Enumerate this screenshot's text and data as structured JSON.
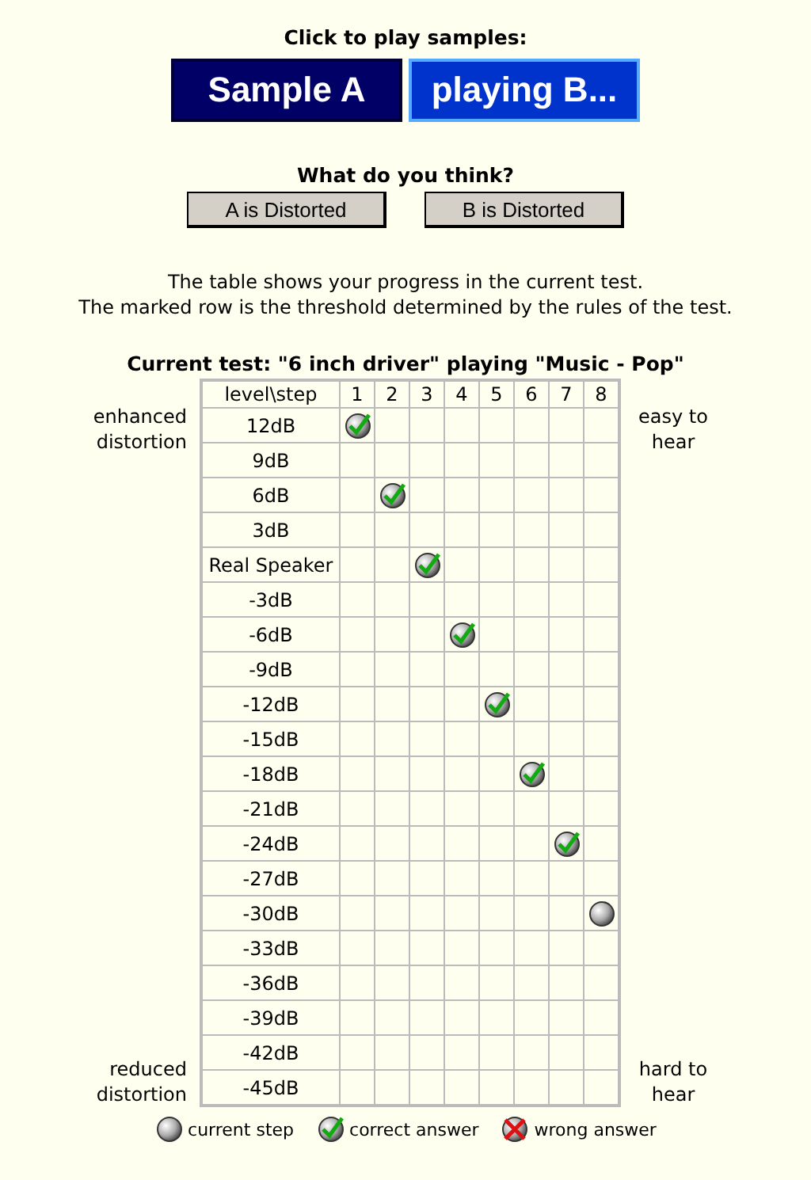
{
  "samples": {
    "heading": "Click to play samples:",
    "buttons": [
      {
        "label": "Sample A",
        "playing": false
      },
      {
        "label": "playing B...",
        "playing": true
      }
    ]
  },
  "vote": {
    "heading": "What do you think?",
    "buttons": [
      "A is Distorted",
      "B is Distorted"
    ]
  },
  "intro": [
    "The table shows your progress in the current test.",
    "The marked row is the threshold determined by the rules of the test."
  ],
  "test_title": "Current test: \"6 inch driver\" playing \"Music - Pop\"",
  "side_labels": {
    "top_left": "enhanced distortion",
    "top_right": "easy to hear",
    "bottom_left": "reduced distortion",
    "bottom_right": "hard to hear"
  },
  "table": {
    "corner": "level\\step",
    "steps": [
      "1",
      "2",
      "3",
      "4",
      "5",
      "6",
      "7",
      "8"
    ],
    "rows": [
      {
        "level": "12dB",
        "cells": [
          {
            "kind": "correct"
          },
          {
            "kind": "empty"
          },
          {
            "kind": "empty"
          },
          {
            "kind": "empty"
          },
          {
            "kind": "empty"
          },
          {
            "kind": "empty"
          },
          {
            "kind": "empty"
          },
          {
            "kind": "empty"
          }
        ]
      },
      {
        "level": "9dB",
        "cells": [
          {
            "kind": "empty"
          },
          {
            "kind": "empty"
          },
          {
            "kind": "empty"
          },
          {
            "kind": "empty"
          },
          {
            "kind": "empty"
          },
          {
            "kind": "empty"
          },
          {
            "kind": "empty"
          },
          {
            "kind": "empty"
          }
        ]
      },
      {
        "level": "6dB",
        "cells": [
          {
            "kind": "empty"
          },
          {
            "kind": "correct"
          },
          {
            "kind": "empty"
          },
          {
            "kind": "empty"
          },
          {
            "kind": "empty"
          },
          {
            "kind": "empty"
          },
          {
            "kind": "empty"
          },
          {
            "kind": "empty"
          }
        ]
      },
      {
        "level": "3dB",
        "cells": [
          {
            "kind": "empty"
          },
          {
            "kind": "empty"
          },
          {
            "kind": "empty"
          },
          {
            "kind": "empty"
          },
          {
            "kind": "empty"
          },
          {
            "kind": "empty"
          },
          {
            "kind": "empty"
          },
          {
            "kind": "empty"
          }
        ]
      },
      {
        "level": "Real Speaker",
        "cells": [
          {
            "kind": "empty"
          },
          {
            "kind": "empty"
          },
          {
            "kind": "correct"
          },
          {
            "kind": "empty"
          },
          {
            "kind": "empty"
          },
          {
            "kind": "empty"
          },
          {
            "kind": "empty"
          },
          {
            "kind": "empty"
          }
        ]
      },
      {
        "level": "-3dB",
        "cells": [
          {
            "kind": "empty"
          },
          {
            "kind": "empty"
          },
          {
            "kind": "empty"
          },
          {
            "kind": "empty"
          },
          {
            "kind": "empty"
          },
          {
            "kind": "empty"
          },
          {
            "kind": "empty"
          },
          {
            "kind": "empty"
          }
        ]
      },
      {
        "level": "-6dB",
        "cells": [
          {
            "kind": "empty"
          },
          {
            "kind": "empty"
          },
          {
            "kind": "empty"
          },
          {
            "kind": "correct"
          },
          {
            "kind": "empty"
          },
          {
            "kind": "empty"
          },
          {
            "kind": "empty"
          },
          {
            "kind": "empty"
          }
        ]
      },
      {
        "level": "-9dB",
        "cells": [
          {
            "kind": "empty"
          },
          {
            "kind": "empty"
          },
          {
            "kind": "empty"
          },
          {
            "kind": "empty"
          },
          {
            "kind": "empty"
          },
          {
            "kind": "empty"
          },
          {
            "kind": "empty"
          },
          {
            "kind": "empty"
          }
        ]
      },
      {
        "level": "-12dB",
        "cells": [
          {
            "kind": "empty"
          },
          {
            "kind": "empty"
          },
          {
            "kind": "empty"
          },
          {
            "kind": "empty"
          },
          {
            "kind": "correct"
          },
          {
            "kind": "empty"
          },
          {
            "kind": "empty"
          },
          {
            "kind": "empty"
          }
        ]
      },
      {
        "level": "-15dB",
        "cells": [
          {
            "kind": "empty"
          },
          {
            "kind": "empty"
          },
          {
            "kind": "empty"
          },
          {
            "kind": "empty"
          },
          {
            "kind": "empty"
          },
          {
            "kind": "empty"
          },
          {
            "kind": "empty"
          },
          {
            "kind": "empty"
          }
        ]
      },
      {
        "level": "-18dB",
        "cells": [
          {
            "kind": "empty"
          },
          {
            "kind": "empty"
          },
          {
            "kind": "empty"
          },
          {
            "kind": "empty"
          },
          {
            "kind": "empty"
          },
          {
            "kind": "correct"
          },
          {
            "kind": "empty"
          },
          {
            "kind": "empty"
          }
        ]
      },
      {
        "level": "-21dB",
        "cells": [
          {
            "kind": "empty"
          },
          {
            "kind": "empty"
          },
          {
            "kind": "empty"
          },
          {
            "kind": "empty"
          },
          {
            "kind": "empty"
          },
          {
            "kind": "empty"
          },
          {
            "kind": "empty"
          },
          {
            "kind": "empty"
          }
        ]
      },
      {
        "level": "-24dB",
        "cells": [
          {
            "kind": "empty"
          },
          {
            "kind": "empty"
          },
          {
            "kind": "empty"
          },
          {
            "kind": "empty"
          },
          {
            "kind": "empty"
          },
          {
            "kind": "empty"
          },
          {
            "kind": "correct"
          },
          {
            "kind": "empty"
          }
        ]
      },
      {
        "level": "-27dB",
        "cells": [
          {
            "kind": "empty"
          },
          {
            "kind": "empty"
          },
          {
            "kind": "empty"
          },
          {
            "kind": "empty"
          },
          {
            "kind": "empty"
          },
          {
            "kind": "empty"
          },
          {
            "kind": "empty"
          },
          {
            "kind": "empty"
          }
        ]
      },
      {
        "level": "-30dB",
        "cells": [
          {
            "kind": "empty"
          },
          {
            "kind": "empty"
          },
          {
            "kind": "empty"
          },
          {
            "kind": "empty"
          },
          {
            "kind": "empty"
          },
          {
            "kind": "empty"
          },
          {
            "kind": "empty"
          },
          {
            "kind": "current"
          }
        ]
      },
      {
        "level": "-33dB",
        "cells": [
          {
            "kind": "empty"
          },
          {
            "kind": "empty"
          },
          {
            "kind": "empty"
          },
          {
            "kind": "empty"
          },
          {
            "kind": "empty"
          },
          {
            "kind": "empty"
          },
          {
            "kind": "empty"
          },
          {
            "kind": "empty"
          }
        ]
      },
      {
        "level": "-36dB",
        "cells": [
          {
            "kind": "empty"
          },
          {
            "kind": "empty"
          },
          {
            "kind": "empty"
          },
          {
            "kind": "empty"
          },
          {
            "kind": "empty"
          },
          {
            "kind": "empty"
          },
          {
            "kind": "empty"
          },
          {
            "kind": "empty"
          }
        ]
      },
      {
        "level": "-39dB",
        "cells": [
          {
            "kind": "empty"
          },
          {
            "kind": "empty"
          },
          {
            "kind": "empty"
          },
          {
            "kind": "empty"
          },
          {
            "kind": "empty"
          },
          {
            "kind": "empty"
          },
          {
            "kind": "empty"
          },
          {
            "kind": "empty"
          }
        ]
      },
      {
        "level": "-42dB",
        "cells": [
          {
            "kind": "empty"
          },
          {
            "kind": "empty"
          },
          {
            "kind": "empty"
          },
          {
            "kind": "empty"
          },
          {
            "kind": "empty"
          },
          {
            "kind": "empty"
          },
          {
            "kind": "empty"
          },
          {
            "kind": "empty"
          }
        ]
      },
      {
        "level": "-45dB",
        "cells": [
          {
            "kind": "empty"
          },
          {
            "kind": "empty"
          },
          {
            "kind": "empty"
          },
          {
            "kind": "empty"
          },
          {
            "kind": "empty"
          },
          {
            "kind": "empty"
          },
          {
            "kind": "empty"
          },
          {
            "kind": "empty"
          }
        ]
      }
    ]
  },
  "legend": [
    {
      "kind": "current",
      "label": "current step"
    },
    {
      "kind": "correct",
      "label": "correct answer"
    },
    {
      "kind": "wrong",
      "label": "wrong answer"
    }
  ]
}
